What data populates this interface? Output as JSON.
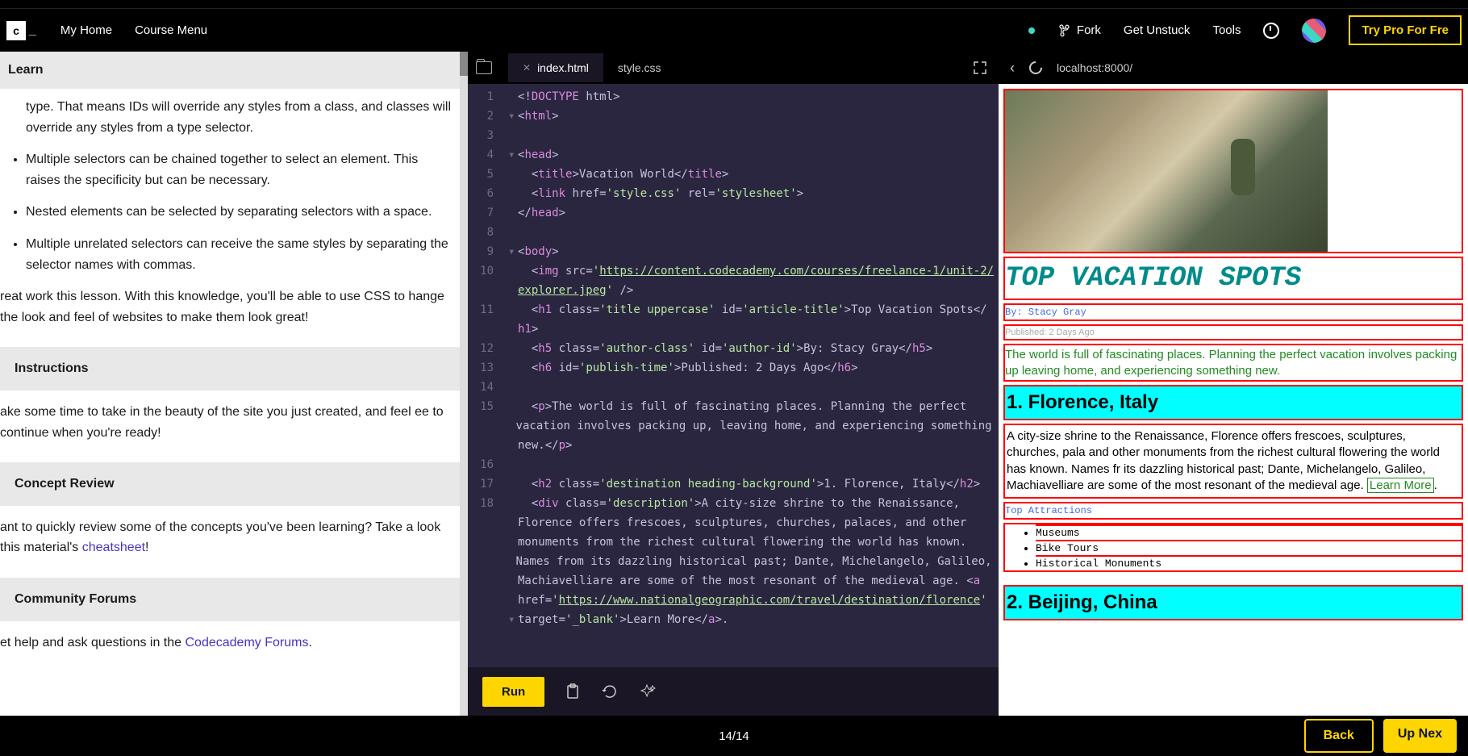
{
  "nav": {
    "logo": "c",
    "home": "My Home",
    "course_menu": "Course Menu",
    "fork": "Fork",
    "get_unstuck": "Get Unstuck",
    "tools": "Tools",
    "try_pro": "Try Pro For Fre"
  },
  "learn": {
    "title": "Learn",
    "partial_top": "type. That means IDs will override any styles from a class, and classes will override any styles from a type selector.",
    "bullets": [
      "Multiple selectors can be chained together to select an element. This raises the specificity but can be necessary.",
      "Nested elements can be selected by separating selectors with a space.",
      "Multiple unrelated selectors can receive the same styles by separating the selector names with commas."
    ],
    "closing": "reat work this lesson. With this knowledge, you'll be able to use CSS to hange the look and feel of websites to make them look great!",
    "instructions_title": "Instructions",
    "instructions_body": "ake some time to take in the beauty of the site you just created, and feel ee to continue when you're ready!",
    "concept_title": "Concept Review",
    "concept_body_pre": "ant to quickly review some of the concepts you've been learning? Take a look  this material's ",
    "concept_link": "cheatsheet",
    "concept_body_post": "!",
    "forums_title": "Community Forums",
    "forums_body_pre": "et help and ask questions in the ",
    "forums_link": "Codecademy Forums",
    "forums_body_post": "."
  },
  "editor": {
    "tabs": [
      "index.html",
      "style.css"
    ],
    "active_tab": 0,
    "code": [
      {
        "n": 1,
        "html": "<span class='punct'>&lt;!</span><span class='tag'>DOCTYPE</span> <span class='attr'>html</span><span class='punct'>&gt;</span>"
      },
      {
        "n": 2,
        "arrow": true,
        "html": "<span class='punct'>&lt;</span><span class='tag'>html</span><span class='punct'>&gt;</span>"
      },
      {
        "n": 3,
        "html": ""
      },
      {
        "n": 4,
        "arrow": true,
        "html": "<span class='punct'>&lt;</span><span class='tag'>head</span><span class='punct'>&gt;</span>"
      },
      {
        "n": 5,
        "html": "  <span class='punct'>&lt;</span><span class='tag'>title</span><span class='punct'>&gt;</span><span class='txt'>Vacation World</span><span class='punct'>&lt;/</span><span class='tag'>title</span><span class='punct'>&gt;</span>"
      },
      {
        "n": 6,
        "html": "  <span class='punct'>&lt;</span><span class='tag'>link</span> <span class='attr'>href</span><span class='punct'>=</span><span class='str'>'style.css'</span> <span class='attr'>rel</span><span class='punct'>=</span><span class='str'>'stylesheet'</span><span class='punct'>&gt;</span>"
      },
      {
        "n": 7,
        "html": "<span class='punct'>&lt;/</span><span class='tag'>head</span><span class='punct'>&gt;</span>"
      },
      {
        "n": 8,
        "html": ""
      },
      {
        "n": 9,
        "arrow": true,
        "html": "<span class='punct'>&lt;</span><span class='tag'>body</span><span class='punct'>&gt;</span>"
      },
      {
        "n": 10,
        "html": "  <span class='punct'>&lt;</span><span class='tag'>img</span> <span class='attr'>src</span><span class='punct'>=</span><span class='str'>'</span><span class='str-url'>https://content.codecademy.com/courses/freelance-1/unit-2/</span>"
      },
      {
        "n": "",
        "html": "<span class='str-url'>explorer.jpeg</span><span class='str'>'</span> <span class='punct'>/&gt;</span>"
      },
      {
        "n": 11,
        "html": "  <span class='punct'>&lt;</span><span class='tag'>h1</span> <span class='attr'>class</span><span class='punct'>=</span><span class='str'>'title uppercase'</span> <span class='attr'>id</span><span class='punct'>=</span><span class='str'>'article-title'</span><span class='punct'>&gt;</span><span class='txt'>Top Vacation Spots</span><span class='punct'>&lt;/</span>"
      },
      {
        "n": "",
        "html": "<span class='tag'>h1</span><span class='punct'>&gt;</span>"
      },
      {
        "n": 12,
        "html": "  <span class='punct'>&lt;</span><span class='tag'>h5</span> <span class='attr'>class</span><span class='punct'>=</span><span class='str'>'author-class'</span> <span class='attr'>id</span><span class='punct'>=</span><span class='str'>'author-id'</span><span class='punct'>&gt;</span><span class='txt'>By: Stacy Gray</span><span class='punct'>&lt;/</span><span class='tag'>h5</span><span class='punct'>&gt;</span>"
      },
      {
        "n": 13,
        "html": "  <span class='punct'>&lt;</span><span class='tag'>h6</span> <span class='attr'>id</span><span class='punct'>=</span><span class='str'>'publish-time'</span><span class='punct'>&gt;</span><span class='txt'>Published: 2 Days Ago</span><span class='punct'>&lt;/</span><span class='tag'>h6</span><span class='punct'>&gt;</span>"
      },
      {
        "n": 14,
        "html": ""
      },
      {
        "n": 15,
        "html": "  <span class='punct'>&lt;</span><span class='tag'>p</span><span class='punct'>&gt;</span><span class='txt'>The world is full of fascinating places. Planning the perfect </span>"
      },
      {
        "n": "",
        "html": "<span class='txt'>vacation involves packing up, leaving home, and experiencing something </span>"
      },
      {
        "n": "",
        "html": "<span class='txt'>new.</span><span class='punct'>&lt;/</span><span class='tag'>p</span><span class='punct'>&gt;</span>"
      },
      {
        "n": 16,
        "html": ""
      },
      {
        "n": 17,
        "html": "  <span class='punct'>&lt;</span><span class='tag'>h2</span> <span class='attr'>class</span><span class='punct'>=</span><span class='str'>'destination heading-background'</span><span class='punct'>&gt;</span><span class='txt'>1. Florence, Italy</span><span class='punct'>&lt;/</span><span class='tag'>h2</span><span class='punct'>&gt;</span>"
      },
      {
        "n": 18,
        "html": "  <span class='punct'>&lt;</span><span class='tag'>div</span> <span class='attr'>class</span><span class='punct'>=</span><span class='str'>'description'</span><span class='punct'>&gt;</span><span class='txt'>A city-size shrine to the Renaissance, </span>"
      },
      {
        "n": "",
        "html": "<span class='txt'>Florence offers frescoes, sculptures, churches, palaces, and other </span>"
      },
      {
        "n": "",
        "html": "<span class='txt'>monuments from the richest cultural flowering the world has known. </span>"
      },
      {
        "n": "",
        "html": "<span class='txt'>Names from its dazzling historical past; Dante, Michelangelo, Galileo, </span>"
      },
      {
        "n": "",
        "html": "<span class='txt'>Machiavelliare are some of the most resonant of the medieval age. </span><span class='punct'>&lt;</span><span class='tag'>a</span> "
      },
      {
        "n": "",
        "html": "<span class='attr'>href</span><span class='punct'>=</span><span class='str'>'</span><span class='str-url'>https://www.nationalgeographic.com/travel/destination/florence</span><span class='str'>'</span> "
      },
      {
        "n": "",
        "arrow": true,
        "html": "<span class='attr'>target</span><span class='punct'>=</span><span class='str'>'_blank'</span><span class='punct'>&gt;</span><span class='txt'>Learn More</span><span class='punct'>&lt;/</span><span class='tag'>a</span><span class='punct'>&gt;.</span>"
      }
    ],
    "run": "Run"
  },
  "preview": {
    "address": "localhost:8000/",
    "h1": "TOP VACATION SPOTS",
    "author": "By: Stacy Gray",
    "publish": "Published: 2 Days Ago",
    "para": "The world is full of fascinating places. Planning the perfect vacation involves packing up leaving home, and experiencing something new.",
    "h2_1": "1. Florence, Italy",
    "desc_1": "A city-size shrine to the Renaissance, Florence offers frescoes, sculptures, churches, pala and other monuments from the richest cultural flowering the world has known. Names fr its dazzling historical past; Dante, Michelangelo, Galileo, Machiavelliare are some of the most resonant of the medieval age. ",
    "learn_more": "Learn More",
    "top_attr": "Top Attractions",
    "attractions": [
      "Museums",
      "Bike Tours",
      "Historical Monuments"
    ],
    "h2_2": "2. Beijing, China"
  },
  "footer": {
    "progress": "14/14",
    "back": "Back",
    "next": "Up Nex"
  }
}
